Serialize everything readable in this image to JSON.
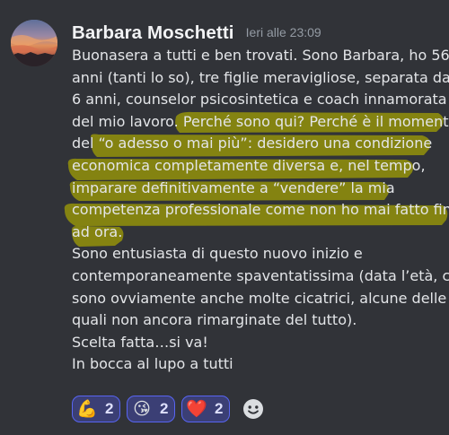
{
  "author": {
    "name": "Barbara Moschetti",
    "timestamp": "Ieri alle 23:09"
  },
  "message": {
    "lines": [
      {
        "text": "Buonasera a tutti e ben trovati. Sono Barbara, ho 56",
        "highlighted": false
      },
      {
        "text": "anni (tanti lo so), tre figlie meravigliose, separata da",
        "highlighted": false
      },
      {
        "text": "6 anni, counselor psicosintetica e coach innamorata",
        "highlighted": false
      },
      {
        "text": "del mio lavoro. ",
        "highlighted": false,
        "continuation": "Perché sono qui? Perché è il momento"
      },
      {
        "text": "del “o adesso o mai più”: desidero una condizione",
        "highlighted": true
      },
      {
        "text": "economica completamente diversa e,  nel tempo,",
        "highlighted": true
      },
      {
        "text": "imparare definitivamente a “vendere” la mia",
        "highlighted": true
      },
      {
        "text": "competenza professionale come non ho mai fatto fino",
        "highlighted": true
      },
      {
        "text": "ad ora.",
        "highlighted": true
      },
      {
        "text": "Sono entusiasta di questo nuovo inizio e",
        "highlighted": false
      },
      {
        "text": "contemporaneamente spaventatissima (data l’età, ci",
        "highlighted": false
      },
      {
        "text": "sono ovviamente anche molte cicatrici, alcune delle",
        "highlighted": false
      },
      {
        "text": "quali non ancora rimarginate del tutto).",
        "highlighted": false
      },
      {
        "text": "Scelta fatta…si va!",
        "highlighted": false
      },
      {
        "text": "In bocca al lupo a tutti",
        "highlighted": false
      }
    ]
  },
  "highlight_color": "#8c8a0e",
  "reactions": [
    {
      "emoji": "💪",
      "icon": "flexed-biceps-icon",
      "count": "2"
    },
    {
      "emoji": "😘",
      "icon": "face-blowing-kiss-icon",
      "count": "2"
    },
    {
      "emoji": "❤️",
      "icon": "red-heart-icon",
      "count": "2"
    }
  ],
  "add_reaction": {
    "icon": "add-reaction-icon"
  },
  "colors": {
    "background": "#313338",
    "reaction_border": "#5865f2",
    "reaction_bg": "#3b3f75",
    "timestamp": "#949ba4"
  }
}
